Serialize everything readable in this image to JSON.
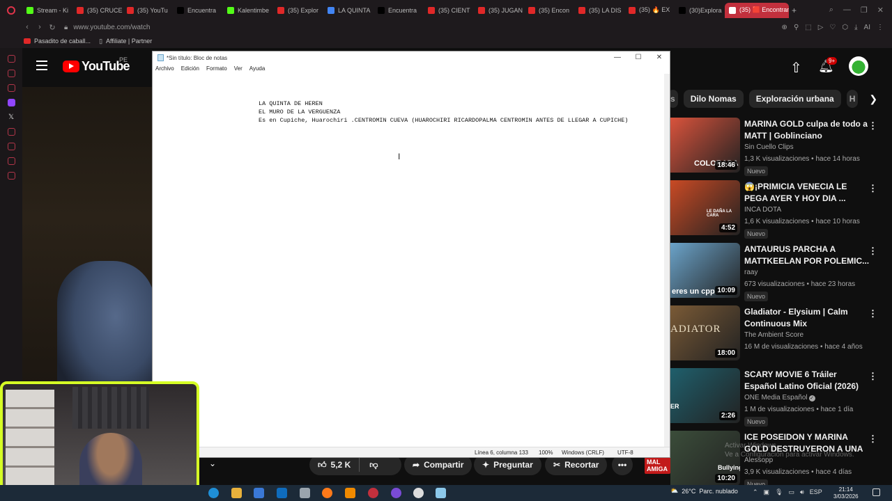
{
  "browser": {
    "tabs": [
      {
        "label": "Stream - Ki",
        "color": "#53fc18"
      },
      {
        "label": "(35) CRUCE",
        "color": "#e02828"
      },
      {
        "label": "(35) YouTu",
        "color": "#e02828"
      },
      {
        "label": "Encuentra",
        "color": "#000000"
      },
      {
        "label": "Kalentimbe",
        "color": "#53fc18"
      },
      {
        "label": "(35) Explor",
        "color": "#e02828"
      },
      {
        "label": "LA QUINTA",
        "color": "#4285f4"
      },
      {
        "label": "Encuentra",
        "color": "#000000"
      },
      {
        "label": "(35) CIENT",
        "color": "#e02828"
      },
      {
        "label": "(35) JUGAN",
        "color": "#e02828"
      },
      {
        "label": "(35) Encon",
        "color": "#e02828"
      },
      {
        "label": "(35) LA DIS",
        "color": "#e02828"
      },
      {
        "label": "(35) 🔥 EX",
        "color": "#e02828"
      },
      {
        "label": "(30)Explora",
        "color": "#000000"
      }
    ],
    "active_tab": "(35) 🟥 Encontramo",
    "url": "www.youtube.com/watch",
    "bookmarks": [
      "Pasadito de caball...",
      "Affiliate | Partner"
    ],
    "toolbar_ai_label": "AI"
  },
  "youtube": {
    "logo_text": "YouTube",
    "country_code": "PE",
    "notification_count": "9+",
    "chips": [
      "s",
      "Dilo Nomas",
      "Exploración urbana",
      "H"
    ],
    "recommendations": [
      {
        "title": "MARINA GOLD culpa de todo a MATT | Goblinciano",
        "channel": "Sin Cuello Clips",
        "meta": "1,3 K visualizaciones • hace 14 horas",
        "badge": "Nuevo",
        "duration": "18:46",
        "thumb": "#d9533c"
      },
      {
        "title": "😱¡PRIMICIA VENECIA LE PEGA AYER Y HOY DIA ...",
        "channel": "INCA DOTA",
        "meta": "1,6 K visualizaciones • hace 10 horas",
        "badge": "Nuevo",
        "duration": "4:52",
        "thumb": "#c94a24"
      },
      {
        "title": "ANTAURUS PARCHA A MATTKEELAN POR POLEMIC...",
        "channel": "raay",
        "meta": "673 visualizaciones • hace 23 horas",
        "badge": "Nuevo",
        "duration": "10:09",
        "thumb": "#6ba3c9"
      },
      {
        "title": "Gladiator - Elysium | Calm Continuous Mix",
        "channel": "The Ambient Score",
        "meta": "16 M de visualizaciones • hace 4 años",
        "badge": "",
        "duration": "18:00",
        "thumb": "#7a5a36"
      },
      {
        "title": "SCARY MOVIE 6 Tráiler Español Latino Oficial (2026)",
        "channel": "ONE Media Español",
        "meta": "1 M de visualizaciones • hace 1 día",
        "badge": "Nuevo",
        "duration": "2:26",
        "thumb": "#1f5f6c"
      },
      {
        "title": "ICE POSEIDON Y MARINA GOLD DESTRUYERON A UNA POBRE...",
        "channel": "Alessopp",
        "meta": "3,9 K visualizaciones • hace 4 días",
        "badge": "Nuevo",
        "duration": "10:20",
        "thumb": "#3b4d3a"
      }
    ],
    "thumb_texts": [
      "COLORADA",
      "LE DAÑA LA CARA",
      "eres un cpp",
      "ADIATOR",
      "ER",
      "Bullying"
    ],
    "actions": {
      "like_count": "5,2 K",
      "share": "Compartir",
      "ask": "Preguntar",
      "clip": "Recortar"
    },
    "overlay_tag": "MAL AMIGA"
  },
  "notepad": {
    "title": "*Sin título: Bloc de notas",
    "menu": [
      "Archivo",
      "Edición",
      "Formato",
      "Ver",
      "Ayuda"
    ],
    "lines": [
      "LA QUINTA DE HEREN",
      "EL MURO DE LA VERGUENZA",
      "Es en Cupiche, Huarochiri .CENTROMIN CUEVA (HUAROCHIRI RICARDOPALMA CENTROMIN ANTES DE LLEGAR A CUPICHE)"
    ],
    "status": {
      "position": "Línea 6, columna 133",
      "zoom": "100%",
      "line_ending": "Windows (CRLF)",
      "encoding": "UTF-8"
    }
  },
  "windows": {
    "activate_line1": "Activar Windows",
    "activate_line2": "Ve a Configuración para activar Windows.",
    "weather_temp": "26°C",
    "weather_desc": "Parc. nublado",
    "lang": "ESP",
    "time": "21:14",
    "date": "3/03/2026"
  }
}
